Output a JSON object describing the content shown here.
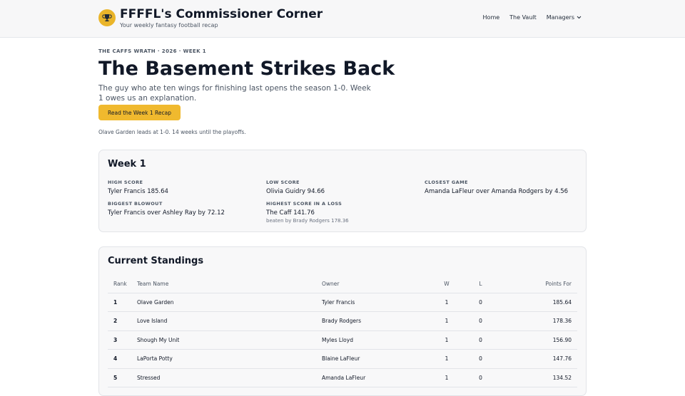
{
  "header": {
    "title": "FFFFL's Commissioner Corner",
    "subtitle": "Your weekly fantasy football recap",
    "logo_icon": "trophy-icon",
    "brand_color": "#eab52a",
    "nav": {
      "home": "Home",
      "vault": "The Vault",
      "managers": "Managers"
    }
  },
  "hero": {
    "eyebrow": "THE CAFFS WRATH · 2026 · WEEK 1",
    "headline": "The Basement Strikes Back",
    "subhead": "The guy who ate ten wings for finishing last opens the season 1-0. Week 1 owes us an explanation.",
    "cta": "Read the Week 1 Recap",
    "note": "Olave Garden leads at 1-0. 14 weeks until the playoffs."
  },
  "week": {
    "title": "Week 1",
    "high_score": {
      "label": "HIGH SCORE",
      "value": "Tyler Francis 185.64"
    },
    "low_score": {
      "label": "LOW SCORE",
      "value": "Olivia Guidry 94.66"
    },
    "closest_game": {
      "label": "CLOSEST GAME",
      "value": "Amanda LaFleur over Amanda Rodgers by 4.56"
    },
    "biggest_blowout": {
      "label": "BIGGEST BLOWOUT",
      "value": "Tyler Francis over Ashley Ray by 72.12"
    },
    "highest_loss": {
      "label": "HIGHEST SCORE IN A LOSS",
      "value": "The Caff 141.76",
      "sub": "beaten by Brady Rodgers 178.36"
    }
  },
  "standings": {
    "title": "Current Standings",
    "columns": {
      "rank": "Rank",
      "team": "Team Name",
      "owner": "Owner",
      "w": "W",
      "l": "L",
      "pf": "Points For"
    },
    "rows": [
      {
        "rank": "1",
        "team": "Olave Garden",
        "owner": "Tyler Francis",
        "w": "1",
        "l": "0",
        "pf": "185.64"
      },
      {
        "rank": "2",
        "team": "Love Island",
        "owner": "Brady Rodgers",
        "w": "1",
        "l": "0",
        "pf": "178.36"
      },
      {
        "rank": "3",
        "team": "Shough My Unit",
        "owner": "Myles Lloyd",
        "w": "1",
        "l": "0",
        "pf": "156.90"
      },
      {
        "rank": "4",
        "team": "LaPorta Potty",
        "owner": "Blaine LaFleur",
        "w": "1",
        "l": "0",
        "pf": "147.76"
      },
      {
        "rank": "5",
        "team": "Stressed",
        "owner": "Amanda LaFleur",
        "w": "1",
        "l": "0",
        "pf": "134.52"
      }
    ]
  }
}
